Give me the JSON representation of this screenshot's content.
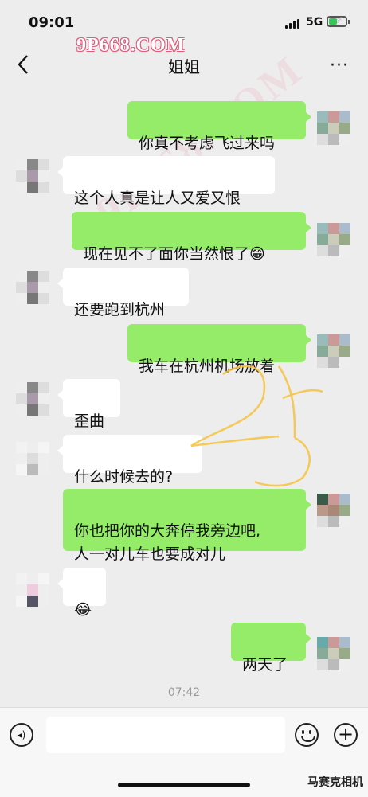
{
  "status": {
    "time": "09:01",
    "network": "5G"
  },
  "watermark": {
    "top": "9P668.COM",
    "diagonal": "9P668.COM"
  },
  "nav": {
    "title": "姐姐",
    "more": "···"
  },
  "messages": [
    {
      "side": "out",
      "text": "你真不考虑飞过来吗"
    },
    {
      "side": "in",
      "text": "这个人真是让人又爱又恨"
    },
    {
      "side": "out",
      "text": "现在见不了面你当然恨了",
      "emoji": "😁"
    },
    {
      "side": "in",
      "text": "还要跑到杭州"
    },
    {
      "side": "out",
      "text": "我车在杭州机场放着"
    },
    {
      "side": "in",
      "text": "歪曲"
    },
    {
      "side": "in",
      "text": "什么时候去的?"
    },
    {
      "side": "out",
      "text": "你也把你的大奔停我旁边吧,\n人一对儿车也要成对儿"
    },
    {
      "side": "in",
      "emoji": "😂"
    },
    {
      "side": "out",
      "text": "两天了"
    }
  ],
  "timestamp": "07:42",
  "corner_watermark": "马赛克相机",
  "colors": {
    "outgoing_bubble": "#95ec69",
    "incoming_bubble": "#ffffff",
    "background": "#ededed"
  }
}
